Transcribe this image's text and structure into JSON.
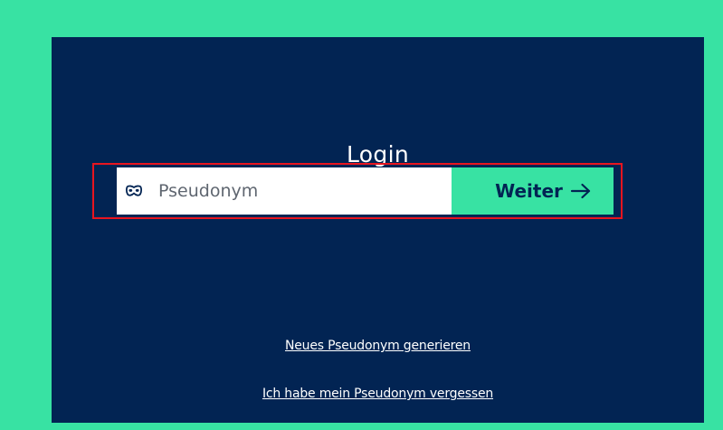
{
  "login": {
    "title": "Login",
    "pseudonym_placeholder": "Pseudonym",
    "pseudonym_value": "",
    "submit_label": "Weiter",
    "submit_icon": "arrow-right-icon",
    "field_icon": "mask-icon"
  },
  "links": {
    "generate": "Neues Pseudonym generieren",
    "forgot": "Ich habe mein Pseudonym vergessen"
  },
  "colors": {
    "background": "#38e2a3",
    "panel": "#022453",
    "accent": "#38e2a3",
    "highlight_border": "#e8151f"
  }
}
